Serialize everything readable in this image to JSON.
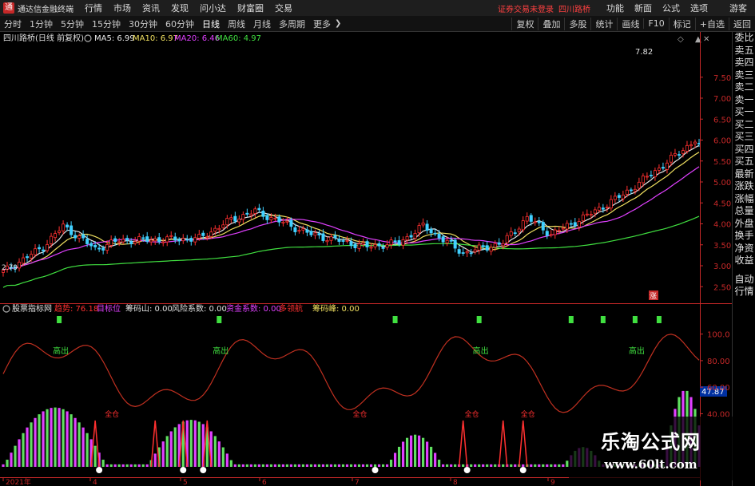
{
  "app": {
    "name": "通达信金融终端",
    "icon": "tdx-logo-icon"
  },
  "menu": [
    "行情",
    "市场",
    "资讯",
    "发现",
    "问小达",
    "财富圈",
    "交易"
  ],
  "title_notice": "证券交易未登录",
  "broker": "四川路桥",
  "right_menu": [
    "功能",
    "新面",
    "公式",
    "选项"
  ],
  "guest_label": "游客",
  "periods": [
    {
      "label": "分时",
      "active": false
    },
    {
      "label": "1分钟",
      "active": false
    },
    {
      "label": "5分钟",
      "active": false
    },
    {
      "label": "15分钟",
      "active": false
    },
    {
      "label": "30分钟",
      "active": false
    },
    {
      "label": "60分钟",
      "active": false
    },
    {
      "label": "日线",
      "active": true
    },
    {
      "label": "周线",
      "active": false
    },
    {
      "label": "月线",
      "active": false
    },
    {
      "label": "多周期",
      "active": false
    },
    {
      "label": "更多",
      "active": false
    }
  ],
  "toolbar_right": [
    "复权",
    "叠加",
    "多股",
    "统计",
    "画线",
    "F10",
    "标记",
    "+自选",
    "返回"
  ],
  "right_panel": {
    "order_book": [
      "委比",
      "卖五",
      "卖四",
      "卖三",
      "卖二",
      "卖一",
      "买一",
      "买二",
      "买三",
      "买四",
      "买五",
      "最新",
      "涨跌",
      "涨幅",
      "总量",
      "外盘",
      "换手",
      "净资",
      "收益"
    ],
    "bottom": [
      "自动",
      "行情"
    ]
  },
  "main": {
    "stock_title": "四川路桥(日线 前复权)",
    "ma": [
      {
        "label": "MA5: 6.99",
        "color": "#e8e8e8"
      },
      {
        "label": "MA10: 6.97",
        "color": "#f0e060"
      },
      {
        "label": "MA20: 6.46",
        "color": "#e040ff"
      },
      {
        "label": "MA60: 4.97",
        "color": "#40e040"
      }
    ],
    "high_label": "7.82",
    "low_label": "2.79",
    "y_ticks": [
      "7.50",
      "7.00",
      "6.50",
      "6.00",
      "5.50",
      "5.00",
      "4.50",
      "4.00",
      "3.50",
      "3.00",
      "2.50"
    ],
    "y_ticks_values": [
      7.5,
      7.0,
      6.5,
      6.0,
      5.5,
      5.0,
      4.5,
      4.0,
      3.5,
      3.0,
      2.5
    ],
    "y_range": [
      2.2,
      8.2
    ],
    "mark_label": "涨"
  },
  "indicator": {
    "name": "股票指标网",
    "legend": [
      {
        "label": "趋势: 76.18",
        "color": "#ff3030"
      },
      {
        "label": "目标位",
        "color": "#e040ff"
      },
      {
        "label": "筹码山: 0.00",
        "color": "#e0e0e0"
      },
      {
        "label": "风险系数: 0.00",
        "color": "#e0e0e0"
      },
      {
        "label": "资金系数: 0.00",
        "color": "#e040ff"
      },
      {
        "label": "多领航",
        "color": "#ff3030"
      },
      {
        "label": "筹码峰: 0.00",
        "color": "#f0e060"
      }
    ],
    "y_ticks": [
      "100.0",
      "80.00",
      "60.00",
      "40.00"
    ],
    "y_ticks_values": [
      100,
      80,
      60,
      40
    ],
    "y_range": [
      0,
      110
    ],
    "current_value": "47.87",
    "gaochu_label": "高出",
    "quancang_label": "全仓"
  },
  "x_axis": {
    "labels": [
      "2021年",
      "4",
      "5",
      "6",
      "7",
      "8",
      "9"
    ]
  },
  "watermark": {
    "line1": "乐淘公式网",
    "line2": "www.60lt.com"
  },
  "colors": {
    "up": "#ff3030",
    "down": "#40d0ff",
    "ma5": "#e8e8e8",
    "ma10": "#f0e060",
    "ma20": "#e040ff",
    "ma60": "#40e040",
    "trend": "#c03020",
    "green_bar": "#60e060",
    "purple_bar": "#e040ff"
  }
}
